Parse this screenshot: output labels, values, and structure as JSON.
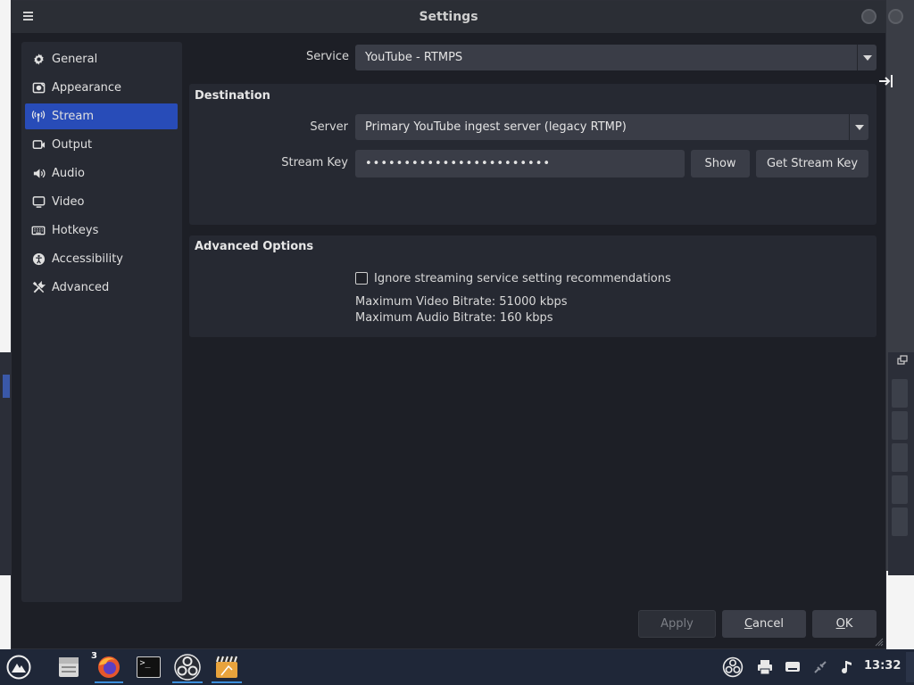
{
  "window": {
    "title": "Settings"
  },
  "sidebar": {
    "items": [
      {
        "label": "General",
        "icon": "gear-icon"
      },
      {
        "label": "Appearance",
        "icon": "appearance-icon"
      },
      {
        "label": "Stream",
        "icon": "antenna-icon",
        "active": true
      },
      {
        "label": "Output",
        "icon": "output-icon"
      },
      {
        "label": "Audio",
        "icon": "speaker-icon"
      },
      {
        "label": "Video",
        "icon": "monitor-icon"
      },
      {
        "label": "Hotkeys",
        "icon": "keyboard-icon"
      },
      {
        "label": "Accessibility",
        "icon": "accessibility-icon"
      },
      {
        "label": "Advanced",
        "icon": "tools-icon"
      }
    ]
  },
  "service": {
    "label": "Service",
    "value": "YouTube - RTMPS"
  },
  "destination": {
    "title": "Destination",
    "server_label": "Server",
    "server_value": "Primary YouTube ingest server (legacy RTMP)",
    "key_label": "Stream Key",
    "key_value": "••••••••••••••••••••••••",
    "show_label": "Show",
    "get_key_label": "Get Stream Key"
  },
  "advanced": {
    "title": "Advanced Options",
    "ignore_label": "Ignore streaming service setting recommendations",
    "ignore_checked": false,
    "max_video": "Maximum Video Bitrate: 51000 kbps",
    "max_audio": "Maximum Audio Bitrate: 160 kbps"
  },
  "footer": {
    "apply_label": "Apply",
    "cancel_label": "Cancel",
    "cancel_underline_char": "C",
    "cancel_rest": "ancel",
    "ok_label": "OK",
    "ok_underline_char": "O",
    "ok_rest": "K"
  },
  "taskbar": {
    "apps": [
      "app-launcher",
      "file-manager",
      "firefox",
      "terminal",
      "obs-studio",
      "video-editor"
    ],
    "firefox_badge": "3",
    "terminal_glyph": ">_",
    "clock": "13:32"
  },
  "colors": {
    "accent": "#284cb8",
    "window_bg": "#1d1f26",
    "taskbar_bg": "#1f2738"
  }
}
